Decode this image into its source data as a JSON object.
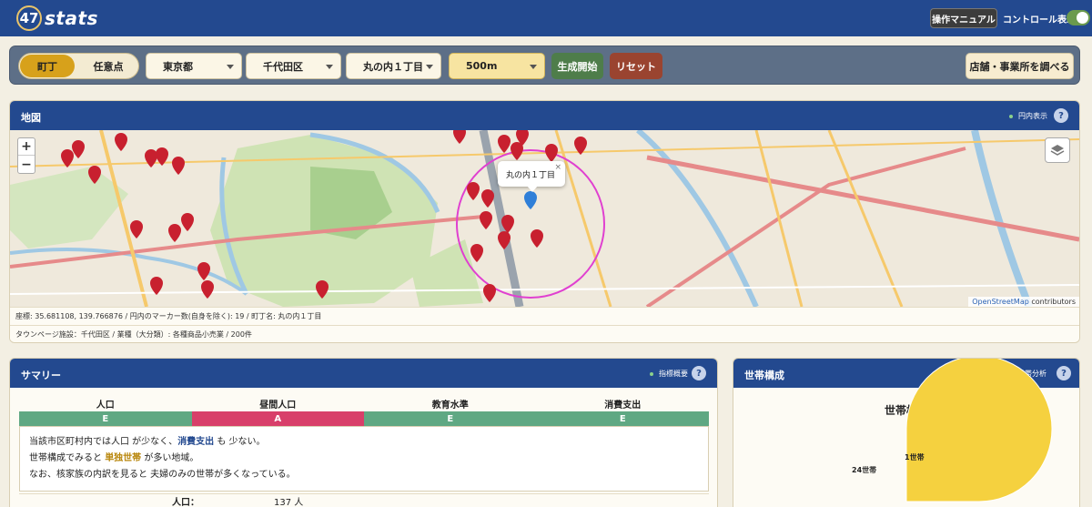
{
  "header": {
    "logo_number": "47",
    "logo_text": "stats",
    "manual_label": "操作マニュアル",
    "control_label": "コントロール表示"
  },
  "controls": {
    "mode_town": "町丁",
    "mode_any": "任意点",
    "prefecture": "東京都",
    "city": "千代田区",
    "town": "丸の内１丁目",
    "radius": "500m",
    "generate_label": "生成開始",
    "reset_label": "リセット",
    "shops_label": "店舗・事業所を調べる"
  },
  "map_panel": {
    "title": "地図",
    "tool_label": "円内表示",
    "help": "?",
    "zoom_in": "+",
    "zoom_out": "−",
    "popup_text": "丸の内１丁目",
    "popup_close": "×",
    "attribution_link": "OpenStreetMap",
    "attribution_rest": " contributors",
    "info_coords": "座標: 35.681108, 139.766876 / 円内のマーカー数(自身を除く): 19 / 町丁名: 丸の内１丁目",
    "info_townpage": "タウンページ施設：千代田区 / 業種（大分類）: 各種商品小売業 / 200件"
  },
  "summary_panel": {
    "title": "サマリー",
    "tool_label": "指標概要",
    "help": "?",
    "headers": [
      "人口",
      "昼間人口",
      "教育水準",
      "消費支出"
    ],
    "grades": [
      "E",
      "A",
      "E",
      "E"
    ],
    "line1_a": "当該市区町村内では人口 が少なく、",
    "line1_kw": "消費支出",
    "line1_b": " も 少ない。",
    "line2_a": "世帯構成でみると ",
    "line2_kw": "単独世帯",
    "line2_b": " が多い地域。",
    "line3": "なお、核家族の内訳を見ると 夫婦のみの世帯が多くなっている。",
    "pop_label": "人口：",
    "pop_value": "137 人"
  },
  "household_panel": {
    "title": "世帯構成",
    "tool_label": "世帯分析",
    "help": "?",
    "chart_title": "世帯構成"
  },
  "colors": {
    "header_blue": "#23498f",
    "grade_e": "#5fa883",
    "grade_a": "#d83f6a",
    "gen_green": "#4e7d4a",
    "reset_red": "#9a4430",
    "mode_gold": "#d7a11b"
  },
  "chart_data": {
    "type": "pie",
    "title": "世帯構成",
    "slices": [
      {
        "label": "1世帯",
        "value": 1,
        "color": "#e05a4f"
      },
      {
        "label": "24世帯",
        "value": 24,
        "color": "#d4a20c"
      },
      {
        "label": "",
        "value": 75,
        "color": "#f5d13f"
      }
    ]
  }
}
